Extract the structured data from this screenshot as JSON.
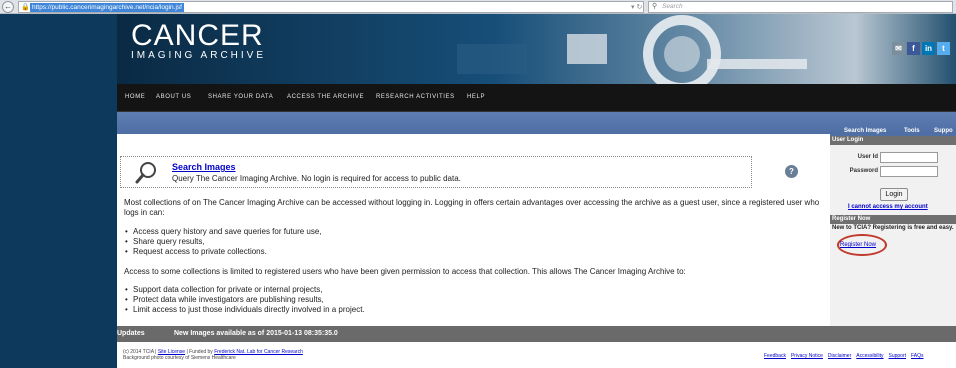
{
  "browser": {
    "url": "https://public.cancerimagingarchive.net/ncia/login.jsf",
    "search_placeholder": "Search"
  },
  "header": {
    "logo_title": "CANCER",
    "logo_subtitle": "IMAGING ARCHIVE",
    "social": [
      "email",
      "f",
      "in",
      "t"
    ]
  },
  "nav": {
    "items": [
      "HOME",
      "ABOUT US",
      "SHARE YOUR DATA",
      "ACCESS THE ARCHIVE",
      "RESEARCH ACTIVITIES",
      "HELP"
    ]
  },
  "main": {
    "search_link": "Search Images",
    "search_desc": "Query The Cancer Imaging Archive. No login is required for access to public data.",
    "help_glyph": "?",
    "intro": "Most collections of on The Cancer Imaging Archive can be accessed without logging in. Logging in offers certain advantages over accessing the archive as a guest user, since a registered user who logs in can:",
    "bullets1": [
      "Access query history and save queries for future use,",
      "Share query results,",
      "Request access to private collections."
    ],
    "access_text": "Access to some collections is limited to registered users who have been given permission to access that collection. This allows The Cancer Imaging Archive to:",
    "bullets2": [
      "Support data collection for private or internal projects,",
      "Protect data while investigators are publishing results,",
      "Limit access to just those individuals directly involved in a project."
    ]
  },
  "sidebar": {
    "tabs": [
      "Search Images",
      "Tools",
      "Suppo"
    ],
    "login_header": "User Login",
    "user_id_label": "User Id",
    "password_label": "Password",
    "login_button": "Login",
    "cannot_access": "I cannot access my account",
    "register_header": "Register Now",
    "register_text": "New to TCIA? Registering is free and easy.",
    "register_link": "Register Now"
  },
  "updates": {
    "label": "Updates",
    "text": "New Images available as of 2015-01-13 08:35:35.0"
  },
  "footer": {
    "line1_prefix": "(c) 2014 TCIA |",
    "site_license": "Site License",
    "line1_mid": "| Funded by",
    "funder": "Frederick Nat. Lab for Cancer Research",
    "line2": "Background photo courtesy of Siemens Healthcare",
    "links": [
      "Feedback",
      "Privacy Notice",
      "Disclaimer",
      "Accessibility",
      "Support",
      "FAQs"
    ]
  }
}
